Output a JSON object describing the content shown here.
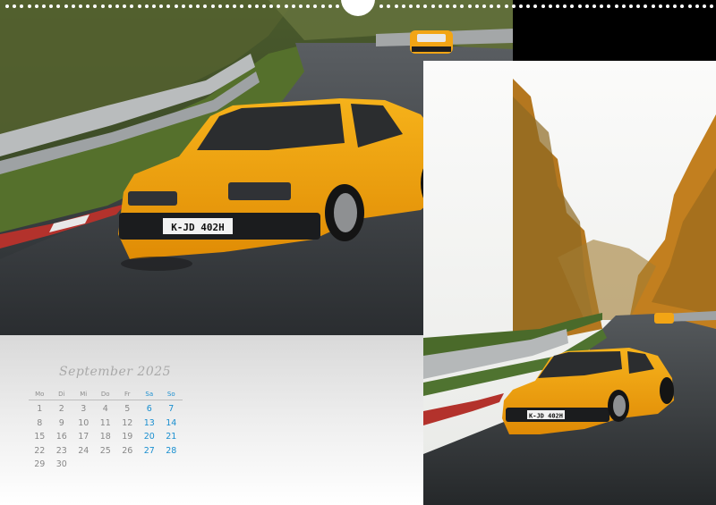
{
  "calendar": {
    "title": "September 2025",
    "weekday_headers": [
      "Mo",
      "Di",
      "Mi",
      "Do",
      "Fr",
      "Sa",
      "So"
    ],
    "weeks": [
      [
        "1",
        "2",
        "3",
        "4",
        "5",
        "6",
        "7"
      ],
      [
        "8",
        "9",
        "10",
        "11",
        "12",
        "13",
        "14"
      ],
      [
        "15",
        "16",
        "17",
        "18",
        "19",
        "20",
        "21"
      ],
      [
        "22",
        "23",
        "24",
        "25",
        "26",
        "27",
        "28"
      ],
      [
        "29",
        "30",
        "",
        "",
        "",
        "",
        ""
      ]
    ],
    "weekend_color": "#1a8fd0",
    "weekday_color": "#888888"
  },
  "photos": {
    "main": {
      "subject": "yellow sports car on race track",
      "license_plate": "K-JD 402H"
    },
    "side": {
      "subject": "yellow sports car on race track with autumn trees",
      "license_plate": "K-JD 402H"
    }
  }
}
